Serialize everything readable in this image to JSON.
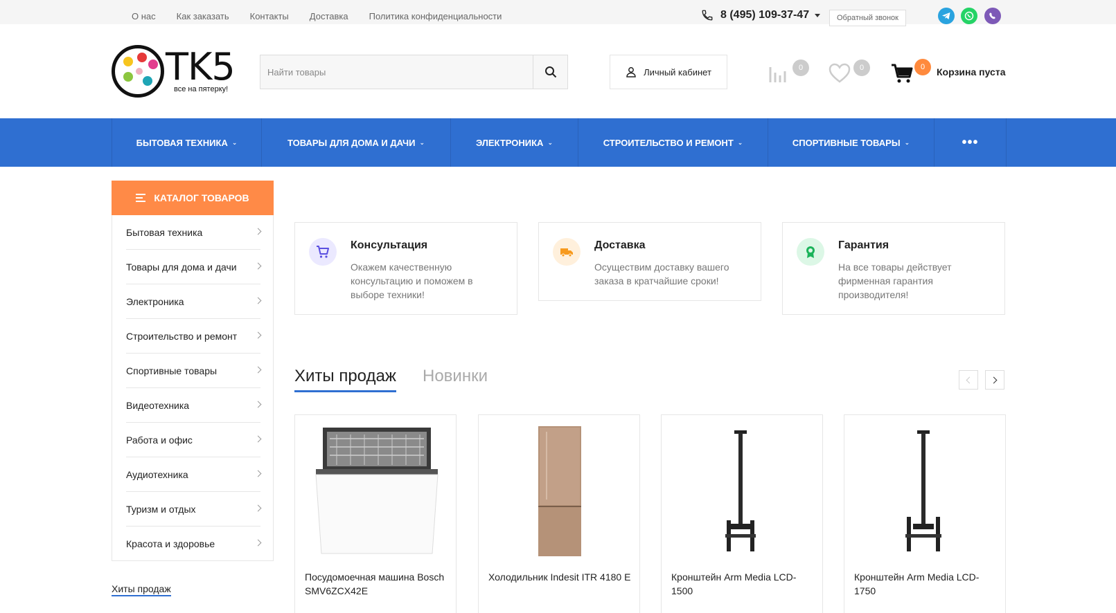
{
  "topbar": {
    "links": [
      "О нас",
      "Как заказать",
      "Контакты",
      "Доставка",
      "Политика конфиденциальности"
    ],
    "phone": "8 (495) 109-37-47",
    "callback": "Обратный звонок",
    "messengers": [
      "telegram-icon",
      "whatsapp-icon",
      "viber-icon"
    ]
  },
  "logo": {
    "text": "TK5",
    "slogan": "все на пятерку!"
  },
  "search": {
    "placeholder": "Найти товары"
  },
  "account": {
    "label": "Личный кабинет"
  },
  "counters": {
    "compare": "0",
    "favorites": "0",
    "cart": "0"
  },
  "cart": {
    "label": "Корзина пуста"
  },
  "nav": {
    "items": [
      "БЫТОВАЯ ТЕХНИКА",
      "ТОВАРЫ ДЛЯ ДОМА И ДАЧИ",
      "ЭЛЕКТРОНИКА",
      "СТРОИТЕЛЬСТВО И РЕМОНТ",
      "СПОРТИВНЫЕ ТОВАРЫ"
    ],
    "more": "•••"
  },
  "catalog": {
    "button": "КАТАЛОГ ТОВАРОВ",
    "items": [
      "Бытовая техника",
      "Товары для дома и дачи",
      "Электроника",
      "Строительство и ремонт",
      "Спортивные товары",
      "Видеотехника",
      "Работа и офис",
      "Аудиотехника",
      "Туризм и отдых",
      "Красота и здоровье"
    ],
    "side_tab": "Хиты продаж"
  },
  "features": [
    {
      "title": "Консультация",
      "text": "Окажем качественную консультацию и поможем в выборе техники!",
      "icon": "cart-icon"
    },
    {
      "title": "Доставка",
      "text": "Осуществим доставку вашего заказа в кратчайшие сроки!",
      "icon": "truck-icon"
    },
    {
      "title": "Гарантия",
      "text": "На все товары действует фирменная гарантия производителя!",
      "icon": "award-icon"
    }
  ],
  "tabs": {
    "hits": "Хиты продаж",
    "new": "Новинки"
  },
  "products": [
    {
      "name": "Посудомоечная машина Bosch SMV6ZCX42E"
    },
    {
      "name": "Холодильник Indesit ITR 4180 E"
    },
    {
      "name": "Кронштейн Arm Media LCD-1500"
    },
    {
      "name": "Кронштейн Arm Media LCD-1750"
    }
  ],
  "colors": {
    "accent": "#2f6fd1",
    "orange": "#ff8a47"
  }
}
